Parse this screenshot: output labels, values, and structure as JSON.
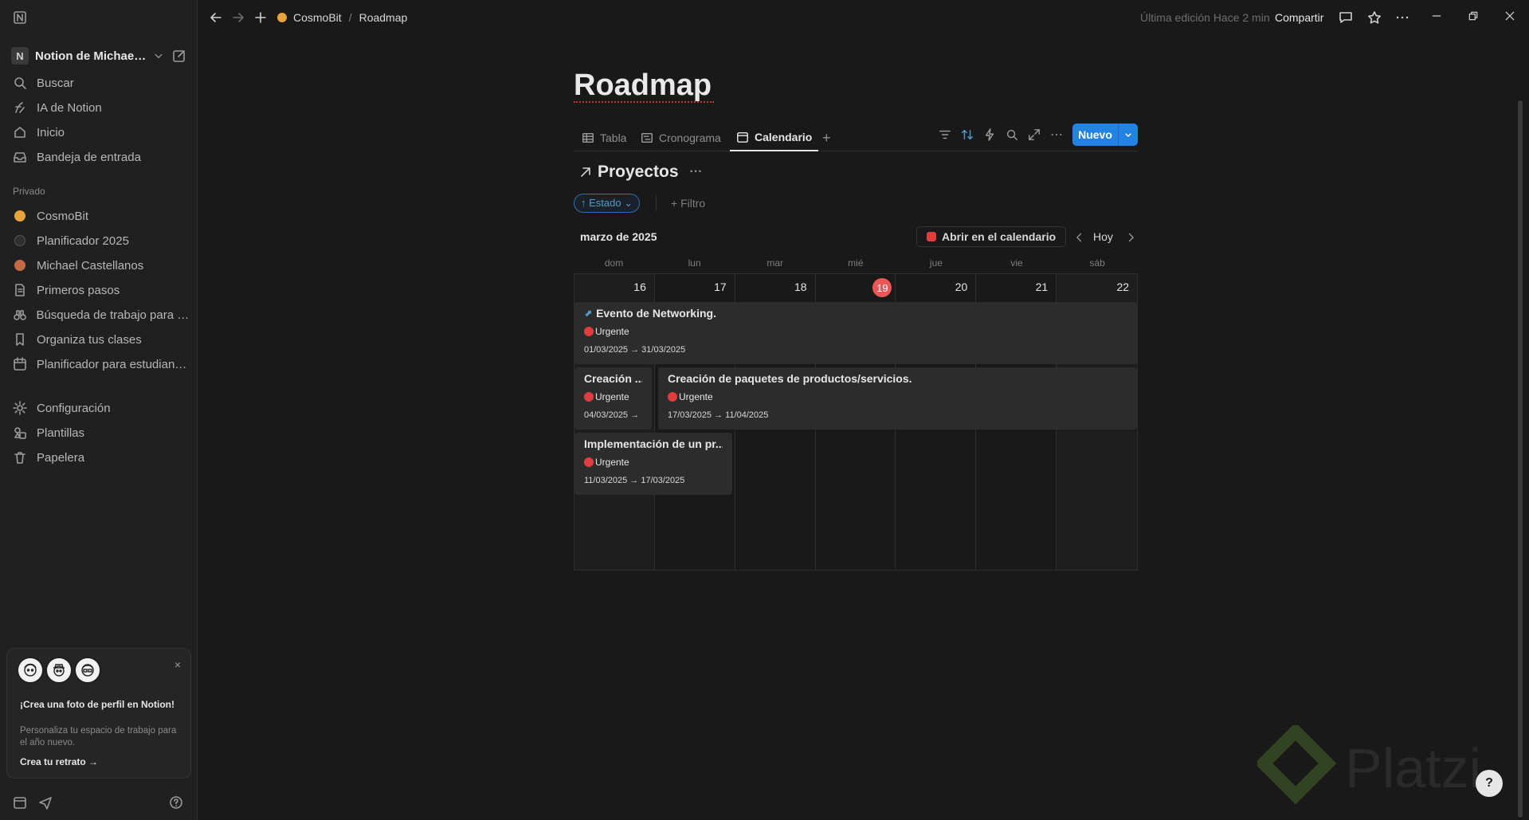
{
  "sidebar": {
    "workspace": {
      "badge": "N",
      "name": "Notion de Michael ..."
    },
    "top_items": [
      {
        "label": "Buscar",
        "icon": "search-icon"
      },
      {
        "label": "IA de Notion",
        "icon": "ai-icon"
      },
      {
        "label": "Inicio",
        "icon": "home-icon"
      },
      {
        "label": "Bandeja de entrada",
        "icon": "inbox-icon"
      }
    ],
    "section_label": "Privado",
    "pages": [
      {
        "label": "CosmoBit",
        "icon": "planet-icon"
      },
      {
        "label": "Planificador 2025",
        "icon": "page-icon"
      },
      {
        "label": "Michael Castellanos",
        "icon": "person-icon"
      },
      {
        "label": "Primeros pasos",
        "icon": "document-icon"
      },
      {
        "label": "Búsqueda de trabajo para e...",
        "icon": "binoculars-icon"
      },
      {
        "label": "Organiza tus clases",
        "icon": "bookmark-icon"
      },
      {
        "label": "Planificador para estudiantes",
        "icon": "calendar-icon"
      }
    ],
    "bottom_items": [
      {
        "label": "Configuración",
        "icon": "gear-icon"
      },
      {
        "label": "Plantillas",
        "icon": "templates-icon"
      },
      {
        "label": "Papelera",
        "icon": "trash-icon"
      }
    ],
    "promo": {
      "title": "¡Crea una foto de perfil en Notion!",
      "description": "Personaliza tu espacio de trabajo para el año nuevo.",
      "link": "Crea tu retrato",
      "close": "×"
    }
  },
  "topbar": {
    "breadcrumb": [
      "CosmoBit",
      "/",
      "Roadmap"
    ],
    "last_edit": "Última edición Hace 2 min",
    "share": "Compartir"
  },
  "page": {
    "title": "Roadmap",
    "tabs": [
      {
        "label": "Tabla",
        "icon": "table-icon",
        "active": false
      },
      {
        "label": "Cronograma",
        "icon": "timeline-icon",
        "active": false
      },
      {
        "label": "Calendario",
        "icon": "calendar-icon",
        "active": true
      }
    ],
    "add_tab": "+",
    "new_button": "Nuevo",
    "database_title": "Proyectos",
    "sort_pill": "↑ Estado ⌄",
    "filter": "+ Filtro"
  },
  "calendar": {
    "month": "marzo de 2025",
    "open_button": "Abrir en el calendario",
    "today_button": "Hoy",
    "weekdays": [
      "dom",
      "lun",
      "mar",
      "mié",
      "jue",
      "vie",
      "sáb"
    ],
    "days": [
      "16",
      "17",
      "18",
      "19",
      "20",
      "21",
      "22"
    ],
    "today": "19",
    "events": [
      {
        "title": "Evento de Networking.",
        "tag": "Urgente",
        "dates": "01/03/2025 → 31/03/2025"
      },
      {
        "title": "Creación ...",
        "tag": "Urgente",
        "dates": "04/03/2025 →"
      },
      {
        "title": "Creación de paquetes de productos/servicios.",
        "tag": "Urgente",
        "dates": "17/03/2025 → 11/04/2025"
      },
      {
        "title": "Implementación de un pr...",
        "tag": "Urgente",
        "dates": "11/03/2025 → 17/03/2025"
      }
    ]
  },
  "colors": {
    "accent": "#2383e2",
    "today": "#eb5757",
    "urgent": "#e03e3e"
  }
}
